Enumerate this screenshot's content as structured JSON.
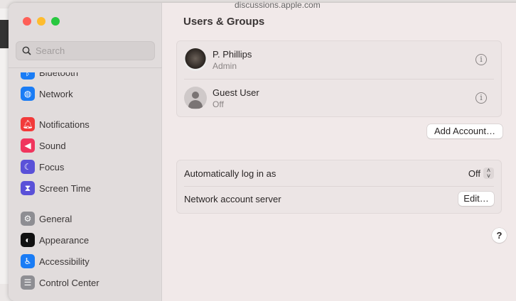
{
  "background": {
    "url": "discussions.apple.com"
  },
  "window": {
    "controls": {
      "close": "#fe5f57",
      "minimize": "#febc2e",
      "zoom": "#28c840"
    }
  },
  "sidebar": {
    "search_placeholder": "Search",
    "items": [
      {
        "label": "Bluetooth",
        "icon": "bluetooth-icon",
        "color": "#1a7cf5"
      },
      {
        "label": "Network",
        "icon": "globe-icon",
        "color": "#1a7cf5"
      },
      {
        "label": "Notifications",
        "icon": "bell-icon",
        "color": "#f23a3a"
      },
      {
        "label": "Sound",
        "icon": "speaker-icon",
        "color": "#f0355d"
      },
      {
        "label": "Focus",
        "icon": "moon-icon",
        "color": "#5a51d8"
      },
      {
        "label": "Screen Time",
        "icon": "hourglass-icon",
        "color": "#5a51d8"
      },
      {
        "label": "General",
        "icon": "gear-icon",
        "color": "#8e8e93"
      },
      {
        "label": "Appearance",
        "icon": "appearance-icon",
        "color": "#111111"
      },
      {
        "label": "Accessibility",
        "icon": "accessibility-icon",
        "color": "#1a7cf5"
      },
      {
        "label": "Control Center",
        "icon": "switches-icon",
        "color": "#8e8e93"
      }
    ]
  },
  "main": {
    "title": "Users & Groups",
    "users": [
      {
        "name": "P. Phillips",
        "role": "Admin"
      },
      {
        "name": "Guest User",
        "role": "Off"
      }
    ],
    "add_account": "Add Account…",
    "auto_login_label": "Automatically log in as",
    "auto_login_value": "Off",
    "network_server_label": "Network account server",
    "edit_button": "Edit…",
    "help": "?",
    "info_glyph": "i"
  }
}
